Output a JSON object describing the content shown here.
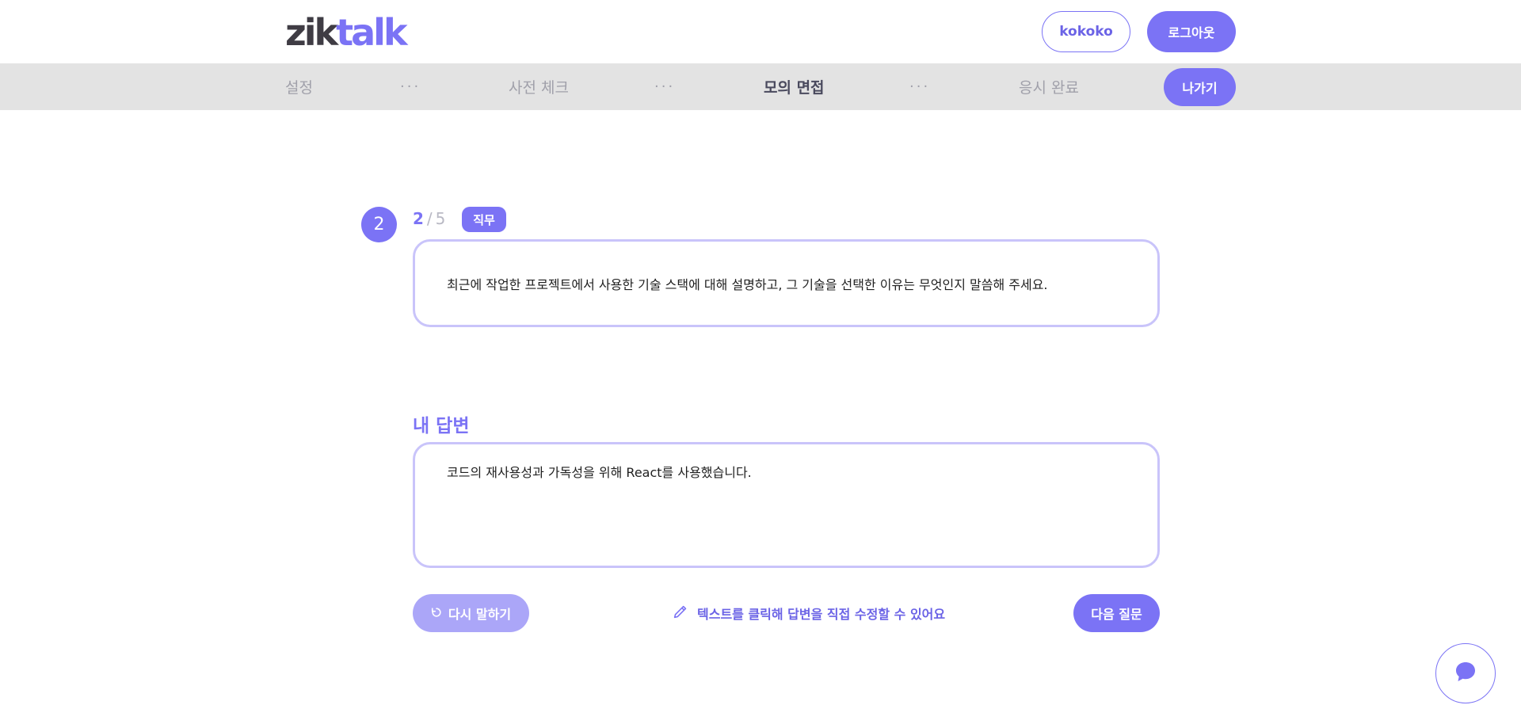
{
  "header": {
    "logo_part1": "zik",
    "logo_part2": "talk",
    "user_button_label": "kokoko",
    "logout_label": "로그아웃"
  },
  "steps": {
    "items": [
      "설정",
      "사전 체크",
      "모의 면접",
      "응시 완료"
    ],
    "active_index": 2,
    "separator": "···",
    "exit_label": "나가기"
  },
  "question": {
    "number": "2",
    "current": "2",
    "separator": "/",
    "total": "5",
    "tag": "직무",
    "text": "최근에 작업한 프로젝트에서 사용한 기술 스택에 대해 설명하고, 그 기술을 선택한 이유는 무엇인지 말씀해 주세요."
  },
  "answer": {
    "title": "내 답변",
    "text": "코드의 재사용성과 가독성을 위해 React를 사용했습니다."
  },
  "actions": {
    "retry_label": "다시 말하기",
    "edit_hint": "텍스트를 클릭해 답변을 직접 수정할 수 있어요",
    "next_label": "다음 질문"
  },
  "colors": {
    "accent": "#7b73f5",
    "accent_light": "#aba6f8",
    "border_light": "#c9c4fa",
    "stepbar_bg": "#e3e3e3"
  },
  "icons": {
    "retry": "refresh-icon",
    "edit": "pencil-icon",
    "chat": "chat-bubble-icon"
  }
}
